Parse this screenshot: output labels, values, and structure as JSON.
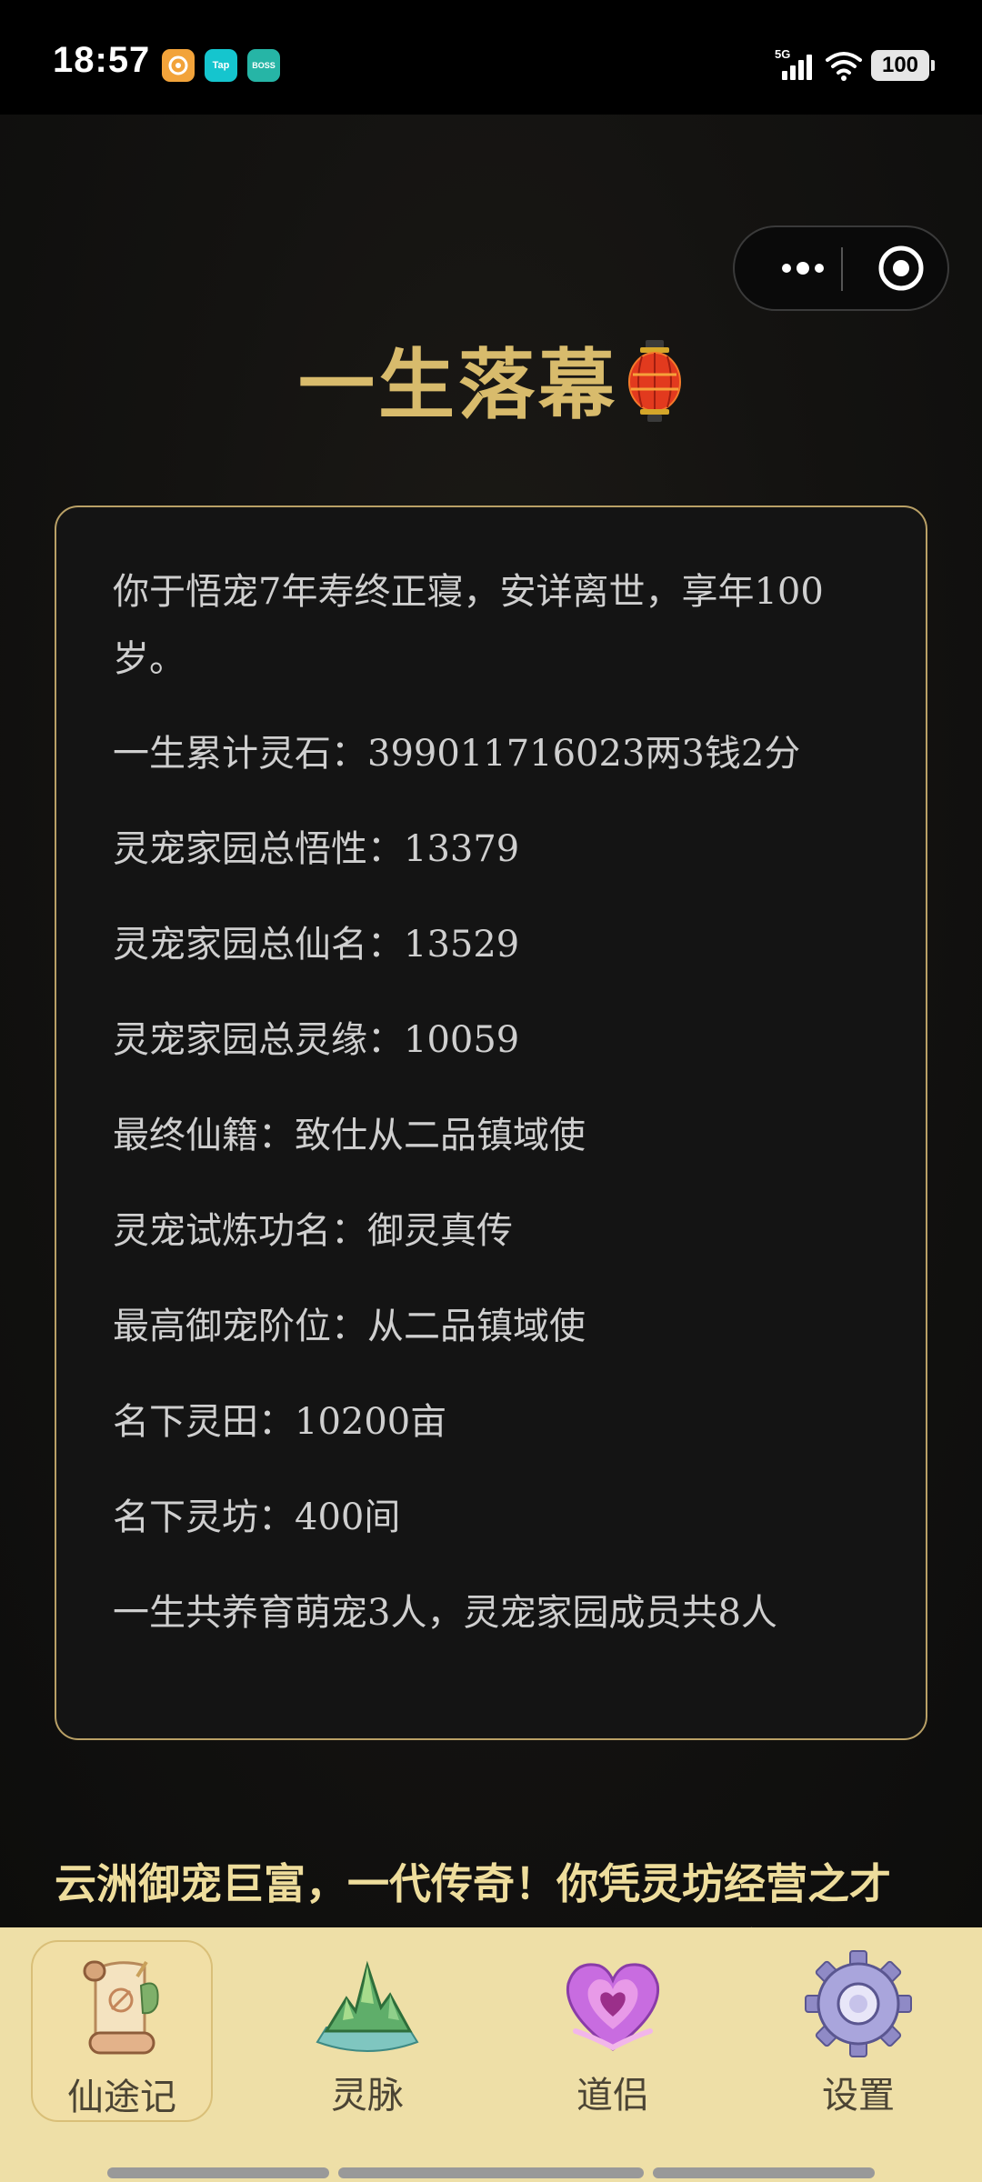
{
  "status_bar": {
    "time": "18:57",
    "network": "5G",
    "battery": "100",
    "app_icons": [
      {
        "name": "orange-app-icon",
        "label": "",
        "color": "#f2a33a"
      },
      {
        "name": "taptap-app-icon",
        "label": "Tap",
        "color": "#15c5ce"
      },
      {
        "name": "boss-app-icon",
        "label": "BOSS",
        "color": "#26b5a6"
      }
    ]
  },
  "page": {
    "title": "一生落幕",
    "title_emoji_icon": "lantern-icon"
  },
  "summary": {
    "lines": [
      "你于悟宠7年寿终正寝，安详离世，享年100岁。",
      "一生累计灵石：399011716023两3钱2分",
      "灵宠家园总悟性：13379",
      "灵宠家园总仙名：13529",
      "灵宠家园总灵缘：10059",
      "最终仙籍：致仕从二品镇域使",
      "灵宠试炼功名：御灵真传",
      "最高御宠阶位：从二品镇域使",
      "名下灵田：10200亩",
      "名下灵坊：400间",
      "一生共养育萌宠3人，灵宠家园成员共8人"
    ]
  },
  "legend": {
    "text": "云洲御宠巨富，一代传奇！你凭灵坊经营之才资源爆仓，灵材行商通达诸州，连远航采宝都不在话下，成为云洲首屈一指的御宠豪商。"
  },
  "nav": {
    "items": [
      {
        "label": "仙途记",
        "icon": "scroll-icon",
        "active": true
      },
      {
        "label": "灵脉",
        "icon": "crystal-mountain-icon",
        "active": false
      },
      {
        "label": "道侣",
        "icon": "heart-icon",
        "active": false
      },
      {
        "label": "设置",
        "icon": "gear-icon",
        "active": false
      }
    ]
  },
  "colors": {
    "gold_title": "#d8bb6c",
    "card_border": "#b9a066",
    "legend_text": "#eedd9c",
    "nav_background": "#eedfa7"
  }
}
